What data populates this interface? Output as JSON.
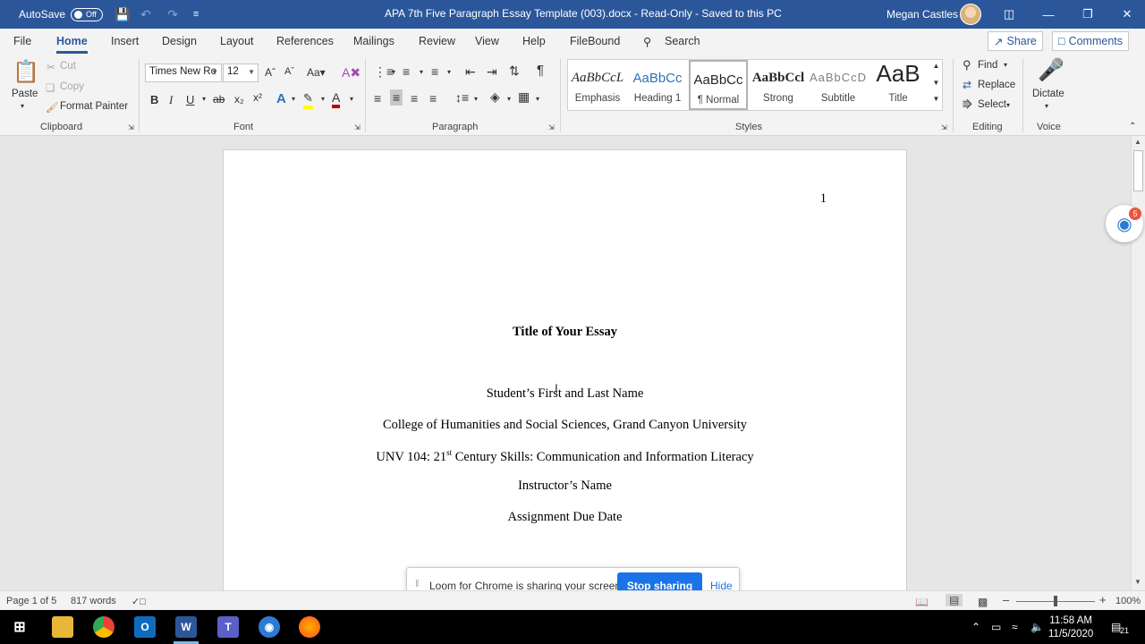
{
  "titlebar": {
    "autosave_label": "AutoSave",
    "autosave_state": "Off",
    "document_title": "APA 7th Five Paragraph Essay Template (003).docx  -  Read-Only  -  Saved to this PC",
    "user_name": "Megan Castles"
  },
  "tabs": [
    {
      "label": "File"
    },
    {
      "label": "Home"
    },
    {
      "label": "Insert"
    },
    {
      "label": "Design"
    },
    {
      "label": "Layout"
    },
    {
      "label": "References"
    },
    {
      "label": "Mailings"
    },
    {
      "label": "Review"
    },
    {
      "label": "View"
    },
    {
      "label": "Help"
    },
    {
      "label": "FileBound"
    }
  ],
  "search_label": "Search",
  "share_label": "Share",
  "comments_label": "Comments",
  "clipboard": {
    "paste": "Paste",
    "cut": "Cut",
    "copy": "Copy",
    "format_painter": "Format Painter",
    "group": "Clipboard"
  },
  "font": {
    "family": "Times New Ro",
    "size": "12",
    "group": "Font",
    "bold": "B",
    "italic": "I",
    "underline": "U"
  },
  "paragraph": {
    "group": "Paragraph"
  },
  "styles": {
    "group": "Styles",
    "items": [
      {
        "sample": "AaBbCcL",
        "name": "Emphasis"
      },
      {
        "sample": "AaBbCc",
        "name": "Heading 1"
      },
      {
        "sample": "AaBbCc",
        "name": "¶ Normal"
      },
      {
        "sample": "AaBbCcl",
        "name": "Strong"
      },
      {
        "sample": "AaBbCcD",
        "name": "Subtitle"
      },
      {
        "sample": "AaB",
        "name": "Title"
      }
    ]
  },
  "editing": {
    "find": "Find",
    "replace": "Replace",
    "select": "Select",
    "group": "Editing"
  },
  "voice": {
    "dictate": "Dictate",
    "group": "Voice"
  },
  "document": {
    "page_number": "1",
    "title": "Title of Your Essay",
    "student": "Student’s First and Last Name",
    "college": "College of Humanities and Social Sciences, Grand Canyon University",
    "course_prefix": "UNV 104: 21",
    "course_sup": "st",
    "course_suffix": " Century Skills: Communication and Information Literacy",
    "instructor": "Instructor’s Name",
    "due_date": "Assignment Due Date"
  },
  "loom": {
    "message": "Loom for Chrome is sharing your screen.",
    "stop": "Stop sharing",
    "hide": "Hide",
    "badge": "5"
  },
  "statusbar": {
    "page": "Page 1 of 5",
    "words": "817 words",
    "zoom": "100%"
  },
  "taskbar": {
    "time": "11:58 AM",
    "date": "11/5/2020",
    "notifications": "21"
  }
}
